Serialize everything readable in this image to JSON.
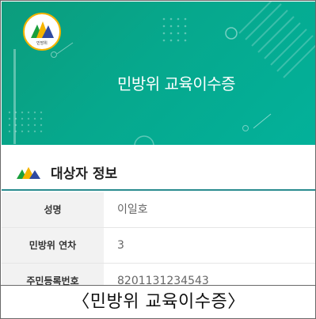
{
  "header": {
    "title": "민방위 교육이수증",
    "logo_text": "민방위",
    "background_color": "#06a88d",
    "logo_icon": "mountain-logo-icon"
  },
  "section": {
    "title": "대상자 정보",
    "icon": "mountain-icon",
    "accent_color": "#2a8c8f"
  },
  "rows": [
    {
      "label": "성명",
      "value": "이일호"
    },
    {
      "label": "민방위 연차",
      "value": "3"
    },
    {
      "label": "주민등록번호",
      "value": "8201131234543"
    }
  ],
  "caption": "〈민방위 교육이수증〉"
}
